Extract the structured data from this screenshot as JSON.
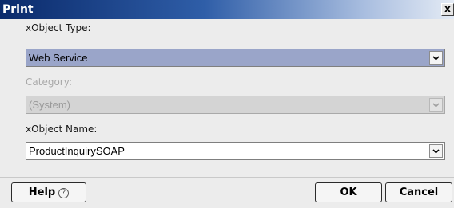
{
  "window": {
    "title": "Print",
    "close_label": "x"
  },
  "form": {
    "xobject_type": {
      "label": "xObject Type:",
      "value": "Web Service"
    },
    "category": {
      "label": "Category:",
      "value": "(System)",
      "disabled": true
    },
    "xobject_name": {
      "label": "xObject Name:",
      "value": "ProductInquirySOAP"
    }
  },
  "buttons": {
    "help_label": "Help",
    "help_icon": "?",
    "ok_label": "OK",
    "cancel_label": "Cancel"
  },
  "colors": {
    "selected_combo": "#9aa5c9",
    "disabled_combo": "#d4d4d4"
  }
}
